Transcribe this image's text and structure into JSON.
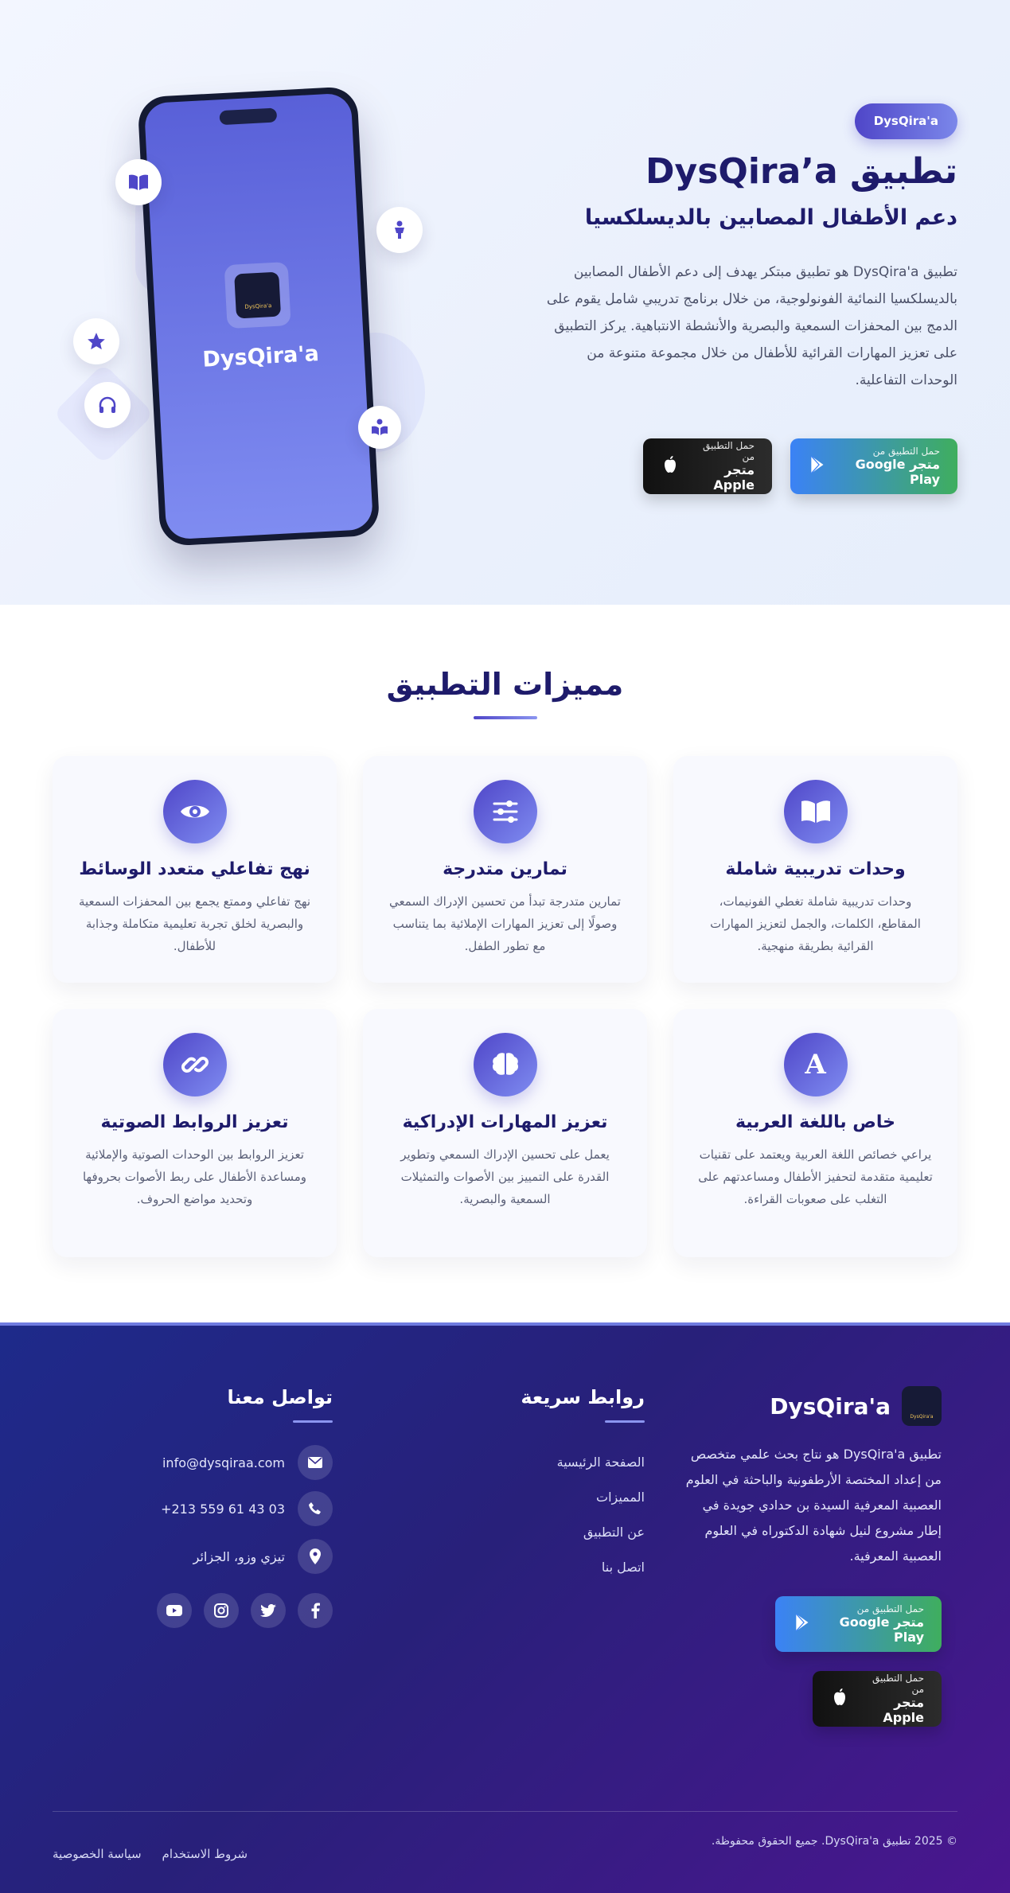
{
  "colors": {
    "primary": "#4f46c8",
    "primary_light": "#7f8cf1",
    "heading": "#1e1b6b",
    "google_btn_start": "#3b82f6",
    "google_btn_end": "#3fae5e",
    "footer_start": "#1e2a8a",
    "footer_end": "#4a168f"
  },
  "hero": {
    "badge": "DysQira'a",
    "title": "تطبيق DysQira’a",
    "subtitle": "دعم الأطفال المصابين بالديسلكسيا",
    "description": "تطبيق DysQira'a هو تطبيق مبتكر يهدف إلى دعم الأطفال المصابين بالديسلكسيا النمائية الفونولوجية، من خلال برنامج تدريبي شامل يقوم على الدمج بين المحفزات السمعية والبصرية والأنشطة الانتباهية. يركز التطبيق على تعزيز المهارات القرائية للأطفال من خلال مجموعة متنوعة من الوحدات التفاعلية.",
    "phone_app_name": "DysQira'a",
    "phone_icon_label": "DysQira'a",
    "float_icons": [
      "book-icon",
      "child-icon",
      "star-icon",
      "headphones-icon",
      "reader-icon"
    ]
  },
  "store_buttons": {
    "google": {
      "small": "حمل التطبيق من",
      "big": "متجر Google Play",
      "icon": "google-play-icon"
    },
    "apple": {
      "small": "حمل التطبيق من",
      "big": "متجر Apple",
      "icon": "apple-icon"
    }
  },
  "features": {
    "title": "مميزات التطبيق",
    "cards": [
      {
        "icon": "book-open-icon",
        "title": "وحدات تدريبية شاملة",
        "desc": "وحدات تدريبية شاملة تغطي الفونيمات، المقاطع، الكلمات، والجمل لتعزيز المهارات القرائية بطريقة منهجية."
      },
      {
        "icon": "sliders-icon",
        "title": "تمارين متدرجة",
        "desc": "تمارين متدرجة تبدأ من تحسين الإدراك السمعي وصولًا إلى تعزيز المهارات الإملائية بما يتناسب مع تطور الطفل."
      },
      {
        "icon": "eye-icon",
        "title": "نهج تفاعلي متعدد الوسائط",
        "desc": "نهج تفاعلي وممتع يجمع بين المحفزات السمعية والبصرية لخلق تجربة تعليمية متكاملة وجذابة للأطفال."
      },
      {
        "icon": "arabic-letter-icon",
        "title": "خاص باللغة العربية",
        "desc": "يراعي خصائص اللغة العربية ويعتمد على تقنيات تعليمية متقدمة لتحفيز الأطفال ومساعدتهم على التغلب على صعوبات القراءة."
      },
      {
        "icon": "brain-icon",
        "title": "تعزيز المهارات الإدراكية",
        "desc": "يعمل على تحسين الإدراك السمعي وتطوير القدرة على التمييز بين الأصوات والتمثيلات السمعية والبصرية."
      },
      {
        "icon": "link-icon",
        "title": "تعزيز الروابط الصوتية",
        "desc": "تعزيز الروابط بين الوحدات الصوتية والإملائية ومساعدة الأطفال على ربط الأصوات بحروفها وتحديد مواضع الحروف."
      }
    ]
  },
  "footer": {
    "brand_name": "DysQira'a",
    "logo_label": "DysQira'a",
    "about": "تطبيق DysQira'a هو نتاج بحث علمي متخصص من إعداد المختصة الأرطفونية والباحثة في العلوم العصبية المعرفية السيدة بن حدادي جويدة في إطار مشروع لنيل شهادة الدكتوراه في العلوم العصبية المعرفية.",
    "links_title": "روابط سريعة",
    "links": [
      "الصفحة الرئيسية",
      "المميزات",
      "عن التطبيق",
      "اتصل بنا"
    ],
    "contact_title": "تواصل معنا",
    "email": "info@dysqiraa.com",
    "phone": "+213 559 61 43 03",
    "address": "تيزي وزو، الجزائر",
    "socials": [
      "facebook-icon",
      "twitter-icon",
      "instagram-icon",
      "youtube-icon"
    ],
    "copyright": "© 2025 تطبيق DysQira'a. جميع الحقوق محفوظة.",
    "terms": "شروط الاستخدام",
    "privacy": "سياسة الخصوصية"
  }
}
